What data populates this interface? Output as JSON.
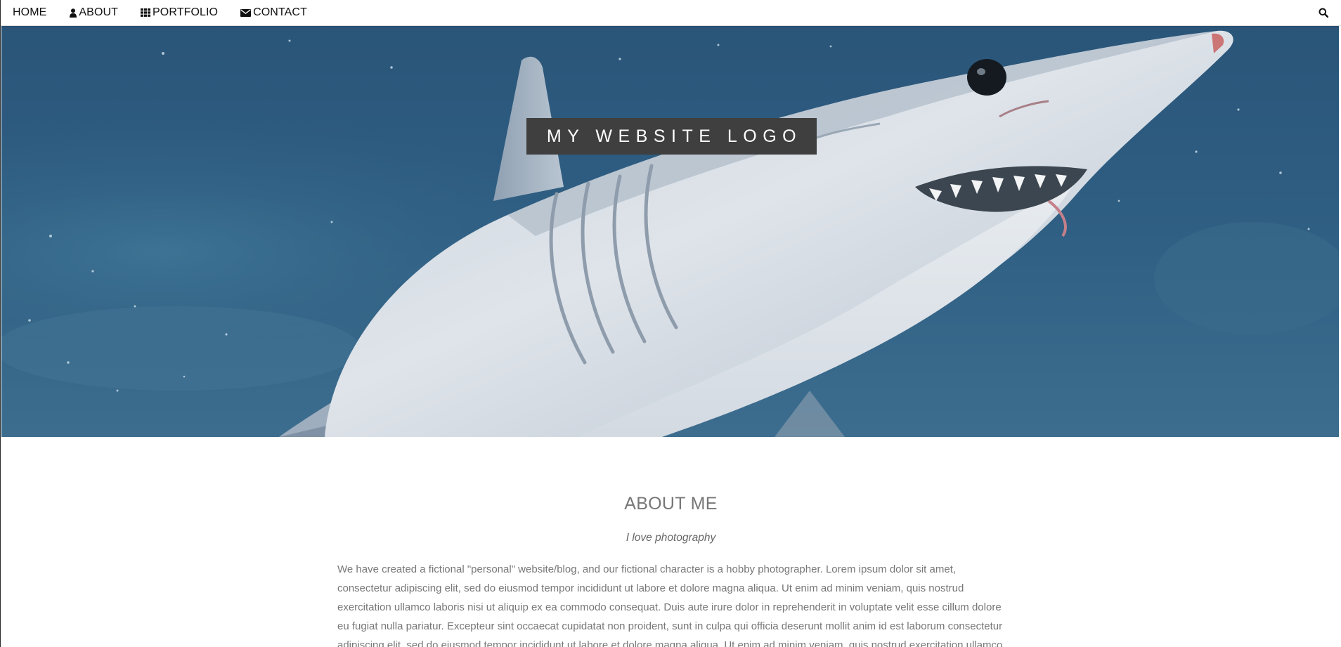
{
  "nav": {
    "items": [
      {
        "label": "HOME",
        "icon": ""
      },
      {
        "label": "ABOUT",
        "icon": "user-icon"
      },
      {
        "label": "PORTFOLIO",
        "icon": "grid-icon"
      },
      {
        "label": "CONTACT",
        "icon": "envelope-icon"
      }
    ],
    "search_icon": "search-icon"
  },
  "hero": {
    "logo_text": "MY WEBSITE LOGO",
    "image": "shark-photo"
  },
  "about": {
    "title": "ABOUT ME",
    "subtitle": "I love photography",
    "body": "We have created a fictional \"personal\" website/blog, and our fictional character is a hobby photographer. Lorem ipsum dolor sit amet, consectetur adipiscing elit, sed do eiusmod tempor incididunt ut labore et dolore magna aliqua. Ut enim ad minim veniam, quis nostrud exercitation ullamco laboris nisi ut aliquip ex ea commodo consequat. Duis aute irure dolor in reprehenderit in voluptate velit esse cillum dolore eu fugiat nulla pariatur. Excepteur sint occaecat cupidatat non proident, sunt in culpa qui officia deserunt mollit anim id est laborum consectetur adipiscing elit, sed do eiusmod tempor incididunt ut labore et dolore magna aliqua. Ut enim ad minim veniam, quis nostrud exercitation ullamco laboris nisi ut aliquip ex ea commodo consequat."
  },
  "colors": {
    "nav_bg": "#ffffff",
    "logo_bg": "#3f3f3f",
    "water": "#2f5d80",
    "text_grey": "#777777"
  }
}
